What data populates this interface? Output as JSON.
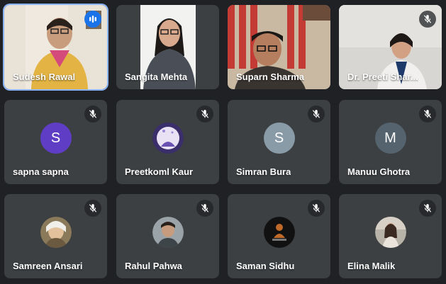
{
  "colors": {
    "tile_bg": "#3c4043",
    "page_bg": "#202124",
    "active_speaker_border": "#8ab4f8",
    "avatar_purple": "#5f3dc4",
    "avatar_gray_blue": "#8a9ba8",
    "avatar_slate": "#54636d"
  },
  "video_tiles": [
    {
      "name": "Sudesh Rawal",
      "mic": "speaking",
      "video": true
    },
    {
      "name": "Sangita Mehta",
      "mic": "none",
      "video": true
    },
    {
      "name": "Suparn Sharma",
      "mic": "none",
      "video": true
    },
    {
      "name": "Dr. Preeti Shar...",
      "mic": "muted",
      "video": true
    }
  ],
  "avatar_tiles": [
    {
      "name": "sapna sapna",
      "initial": "S",
      "avatar_type": "letter",
      "color": "#5f3dc4",
      "mic": "muted"
    },
    {
      "name": "Preetkoml Kaur",
      "initial": "",
      "avatar_type": "photo",
      "mic": "muted"
    },
    {
      "name": "Simran Bura",
      "initial": "S",
      "avatar_type": "letter",
      "color": "#8a9ba8",
      "mic": "muted"
    },
    {
      "name": "Manuu Ghotra",
      "initial": "M",
      "avatar_type": "letter",
      "color": "#54636d",
      "mic": "muted"
    },
    {
      "name": "Samreen Ansari",
      "initial": "",
      "avatar_type": "photo",
      "mic": "muted"
    },
    {
      "name": "Rahul Pahwa",
      "initial": "",
      "avatar_type": "photo",
      "mic": "muted"
    },
    {
      "name": "Saman Sidhu",
      "initial": "",
      "avatar_type": "photo",
      "mic": "muted"
    },
    {
      "name": "Elina Malik",
      "initial": "",
      "avatar_type": "photo",
      "mic": "muted"
    }
  ]
}
